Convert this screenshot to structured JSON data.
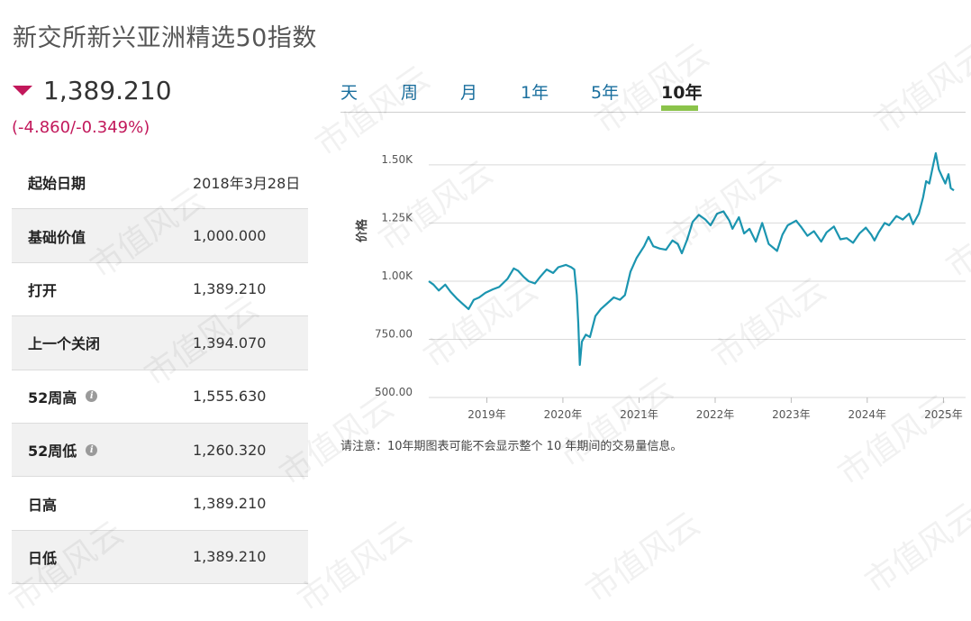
{
  "header": {
    "title": "新交所新兴亚洲精选50指数"
  },
  "quote": {
    "price": "1,389.210",
    "change": "(-4.860/-0.349%)",
    "direction": "down",
    "down_color": "#c2185b"
  },
  "stats": [
    {
      "label": "起始日期",
      "value": "2018年3月28日",
      "info": false
    },
    {
      "label": "基础价值",
      "value": "1,000.000",
      "info": false
    },
    {
      "label": "打开",
      "value": "1,389.210",
      "info": false
    },
    {
      "label": "上一个关闭",
      "value": "1,394.070",
      "info": false
    },
    {
      "label": "52周高",
      "value": "1,555.630",
      "info": true
    },
    {
      "label": "52周低",
      "value": "1,260.320",
      "info": true
    },
    {
      "label": "日高",
      "value": "1,389.210",
      "info": false
    },
    {
      "label": "日低",
      "value": "1,389.210",
      "info": false
    }
  ],
  "tabs": [
    {
      "label": "天",
      "active": false
    },
    {
      "label": "周",
      "active": false
    },
    {
      "label": "月",
      "active": false
    },
    {
      "label": "1年",
      "active": false
    },
    {
      "label": "5年",
      "active": false
    },
    {
      "label": "10年",
      "active": true
    }
  ],
  "chart_data": {
    "type": "line",
    "ylabel": "价格",
    "ylim": [
      500,
      1550
    ],
    "xlim": [
      "2018-03-28",
      "2025-02-20"
    ],
    "yticks": [
      {
        "value": 500,
        "label": "500.00"
      },
      {
        "value": 750,
        "label": "750.00"
      },
      {
        "value": 1000,
        "label": "1.00K"
      },
      {
        "value": 1250,
        "label": "1.25K"
      },
      {
        "value": 1500,
        "label": "1.50K"
      }
    ],
    "xticks": [
      {
        "date": "2019-01-01",
        "label": "2019年"
      },
      {
        "date": "2020-01-01",
        "label": "2020年"
      },
      {
        "date": "2021-01-01",
        "label": "2021年"
      },
      {
        "date": "2022-01-01",
        "label": "2022年"
      },
      {
        "date": "2023-01-01",
        "label": "2023年"
      },
      {
        "date": "2024-01-01",
        "label": "2024年"
      },
      {
        "date": "2025-01-01",
        "label": "2025年"
      }
    ],
    "line_color": "#1b95b0",
    "grid": true,
    "series": [
      {
        "points": [
          [
            "2018-03-28",
            1000
          ],
          [
            "2018-04-20",
            985
          ],
          [
            "2018-05-15",
            960
          ],
          [
            "2018-06-15",
            985
          ],
          [
            "2018-07-10",
            955
          ],
          [
            "2018-08-10",
            925
          ],
          [
            "2018-09-10",
            900
          ],
          [
            "2018-10-05",
            880
          ],
          [
            "2018-10-30",
            920
          ],
          [
            "2018-11-25",
            930
          ],
          [
            "2018-12-25",
            950
          ],
          [
            "2019-01-30",
            965
          ],
          [
            "2019-03-01",
            975
          ],
          [
            "2019-04-10",
            1010
          ],
          [
            "2019-05-10",
            1055
          ],
          [
            "2019-05-30",
            1045
          ],
          [
            "2019-06-25",
            1020
          ],
          [
            "2019-07-20",
            1000
          ],
          [
            "2019-08-20",
            990
          ],
          [
            "2019-09-15",
            1020
          ],
          [
            "2019-10-15",
            1050
          ],
          [
            "2019-11-15",
            1035
          ],
          [
            "2019-12-10",
            1060
          ],
          [
            "2020-01-15",
            1070
          ],
          [
            "2020-02-10",
            1060
          ],
          [
            "2020-02-25",
            1050
          ],
          [
            "2020-03-08",
            940
          ],
          [
            "2020-03-15",
            820
          ],
          [
            "2020-03-22",
            640
          ],
          [
            "2020-04-01",
            740
          ],
          [
            "2020-04-20",
            770
          ],
          [
            "2020-05-10",
            760
          ],
          [
            "2020-06-05",
            850
          ],
          [
            "2020-07-01",
            880
          ],
          [
            "2020-08-01",
            905
          ],
          [
            "2020-09-01",
            930
          ],
          [
            "2020-10-01",
            920
          ],
          [
            "2020-10-25",
            940
          ],
          [
            "2020-11-20",
            1040
          ],
          [
            "2020-12-20",
            1100
          ],
          [
            "2021-01-25",
            1150
          ],
          [
            "2021-02-15",
            1190
          ],
          [
            "2021-03-10",
            1150
          ],
          [
            "2021-04-10",
            1140
          ],
          [
            "2021-05-10",
            1135
          ],
          [
            "2021-06-10",
            1175
          ],
          [
            "2021-07-05",
            1160
          ],
          [
            "2021-07-25",
            1120
          ],
          [
            "2021-08-20",
            1180
          ],
          [
            "2021-09-15",
            1255
          ],
          [
            "2021-10-15",
            1285
          ],
          [
            "2021-11-15",
            1265
          ],
          [
            "2021-12-10",
            1240
          ],
          [
            "2022-01-10",
            1290
          ],
          [
            "2022-02-10",
            1300
          ],
          [
            "2022-03-10",
            1260
          ],
          [
            "2022-03-25",
            1225
          ],
          [
            "2022-04-25",
            1275
          ],
          [
            "2022-05-20",
            1205
          ],
          [
            "2022-06-15",
            1225
          ],
          [
            "2022-07-15",
            1170
          ],
          [
            "2022-08-15",
            1250
          ],
          [
            "2022-09-15",
            1160
          ],
          [
            "2022-10-25",
            1130
          ],
          [
            "2022-11-20",
            1200
          ],
          [
            "2022-12-15",
            1240
          ],
          [
            "2023-01-25",
            1260
          ],
          [
            "2023-02-20",
            1230
          ],
          [
            "2023-03-20",
            1195
          ],
          [
            "2023-04-20",
            1215
          ],
          [
            "2023-05-25",
            1170
          ],
          [
            "2023-06-20",
            1210
          ],
          [
            "2023-07-25",
            1235
          ],
          [
            "2023-08-25",
            1180
          ],
          [
            "2023-09-25",
            1185
          ],
          [
            "2023-10-25",
            1165
          ],
          [
            "2023-11-25",
            1205
          ],
          [
            "2023-12-25",
            1230
          ],
          [
            "2024-01-20",
            1200
          ],
          [
            "2024-02-05",
            1175
          ],
          [
            "2024-02-25",
            1210
          ],
          [
            "2024-03-25",
            1250
          ],
          [
            "2024-04-15",
            1240
          ],
          [
            "2024-05-20",
            1280
          ],
          [
            "2024-06-20",
            1265
          ],
          [
            "2024-07-20",
            1290
          ],
          [
            "2024-08-08",
            1245
          ],
          [
            "2024-09-05",
            1290
          ],
          [
            "2024-09-25",
            1360
          ],
          [
            "2024-10-10",
            1430
          ],
          [
            "2024-10-25",
            1420
          ],
          [
            "2024-11-15",
            1510
          ],
          [
            "2024-11-25",
            1550
          ],
          [
            "2024-12-10",
            1480
          ],
          [
            "2024-12-25",
            1450
          ],
          [
            "2025-01-10",
            1420
          ],
          [
            "2025-01-25",
            1460
          ],
          [
            "2025-02-05",
            1400
          ],
          [
            "2025-02-20",
            1390
          ]
        ]
      }
    ]
  },
  "chart_note": "请注意：10年期图表可能不会显示整个 10 年期间的交易量信息。",
  "watermark": "市值风云"
}
